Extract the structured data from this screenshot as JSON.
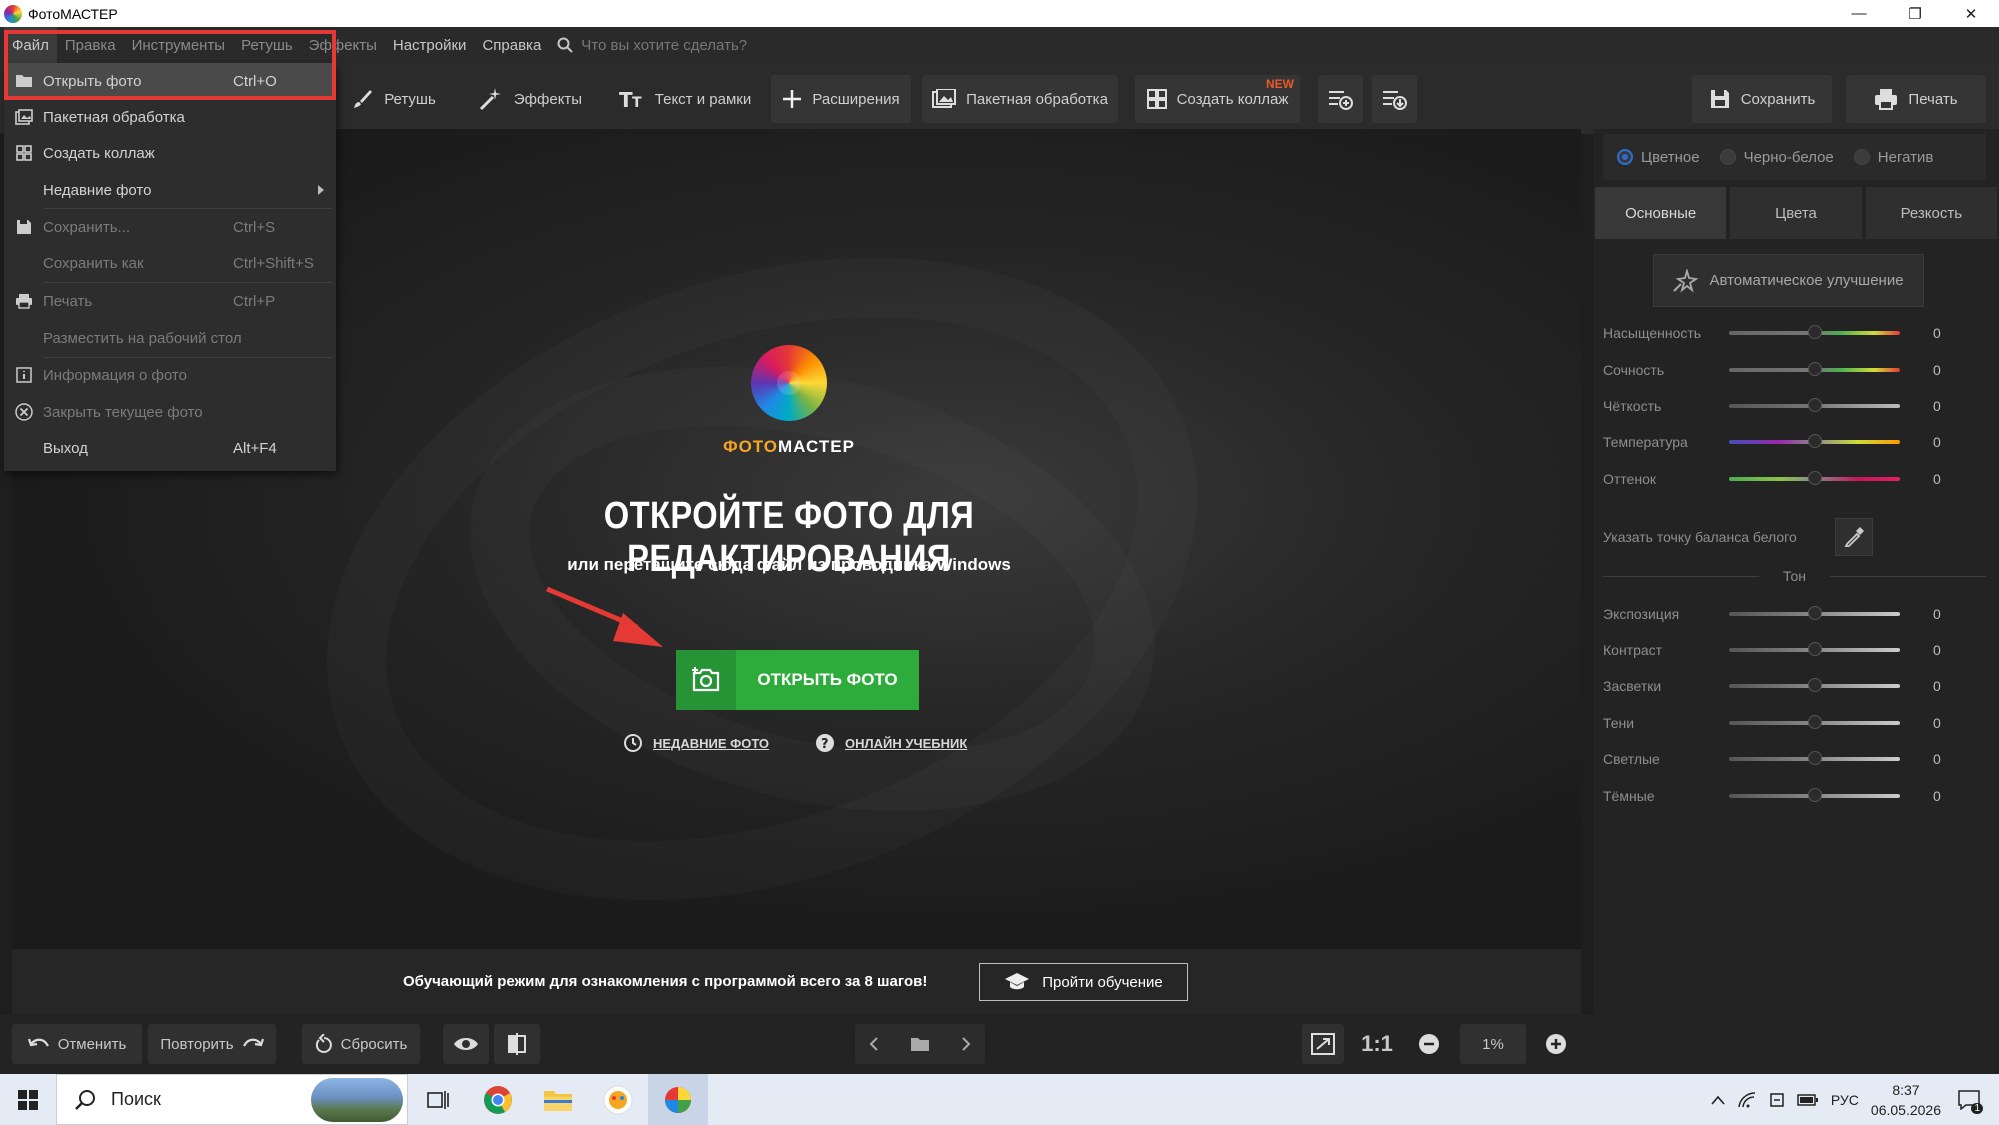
{
  "window": {
    "title": "ФотоМАСТЕР",
    "min": "—",
    "restore": "❐",
    "close": "✕"
  },
  "menubar": {
    "items": [
      "Файл",
      "Правка",
      "Инструменты",
      "Ретушь",
      "Эффекты",
      "Настройки",
      "Справка"
    ],
    "search_placeholder": "Что вы хотите сделать?"
  },
  "toolbar": {
    "retouch": "Ретушь",
    "effects": "Эффекты",
    "text_frames": "Текст и рамки",
    "extensions": "Расширения",
    "batch": "Пакетная обработка",
    "collage": "Создать коллаж",
    "collage_badge": "NEW",
    "save": "Сохранить",
    "print": "Печать"
  },
  "file_menu": {
    "items": [
      {
        "label": "Открыть фото",
        "shortcut": "Ctrl+O",
        "icon": "folder-icon",
        "enabled": true,
        "highlighted": true
      },
      {
        "label": "Пакетная обработка",
        "shortcut": "",
        "icon": "images-icon",
        "enabled": true
      },
      {
        "label": "Создать коллаж",
        "shortcut": "",
        "icon": "collage-icon",
        "enabled": true
      },
      {
        "label": "Недавние фото",
        "shortcut": "",
        "icon": "",
        "enabled": true,
        "submenu": true
      },
      {
        "label": "Сохранить...",
        "shortcut": "Ctrl+S",
        "icon": "save-icon",
        "enabled": false
      },
      {
        "label": "Сохранить как",
        "shortcut": "Ctrl+Shift+S",
        "icon": "",
        "enabled": false
      },
      {
        "label": "Печать",
        "shortcut": "Ctrl+P",
        "icon": "printer-icon",
        "enabled": false
      },
      {
        "label": "Разместить на рабочий стол",
        "shortcut": "",
        "icon": "",
        "enabled": false
      },
      {
        "label": "Информация о фото",
        "shortcut": "",
        "icon": "info-icon",
        "enabled": false
      },
      {
        "label": "Закрыть текущее фото",
        "shortcut": "",
        "icon": "close-circle-icon",
        "enabled": false
      },
      {
        "label": "Выход",
        "shortcut": "Alt+F4",
        "icon": "",
        "enabled": true
      }
    ]
  },
  "welcome": {
    "brand_part1": "ФОТО",
    "brand_part2": "МАСТЕР",
    "headline": "ОТКРОЙТЕ ФОТО ДЛЯ РЕДАКТИРОВАНИЯ",
    "subline": "или перетащите сюда файл из проводника Windows",
    "open_button": "ОТКРЫТЬ ФОТО",
    "recent_link": "НЕДАВНИЕ ФОТО",
    "tutorial_link": "ОНЛАЙН УЧЕБНИК"
  },
  "tutorial_bar": {
    "text": "Обучающий режим для ознакомления с программой всего за 8 шагов!",
    "button": "Пройти обучение"
  },
  "bottombar": {
    "undo": "Отменить",
    "redo": "Повторить",
    "reset": "Сбросить",
    "ratio": "1:1",
    "zoom": "1%"
  },
  "right_panel": {
    "color_modes": [
      "Цветное",
      "Черно-белое",
      "Негатив"
    ],
    "selected_mode": "Цветное",
    "tabs": [
      "Основные",
      "Цвета",
      "Резкость"
    ],
    "active_tab": "Основные",
    "auto_button": "Автоматическое улучшение",
    "sliders": [
      {
        "label": "Насыщенность",
        "value": "0"
      },
      {
        "label": "Сочность",
        "value": "0"
      },
      {
        "label": "Чёткость",
        "value": "0"
      },
      {
        "label": "Температура",
        "value": "0"
      },
      {
        "label": "Оттенок",
        "value": "0"
      }
    ],
    "white_balance": "Указать точку баланса белого",
    "tone_title": "Тон",
    "tone_sliders": [
      {
        "label": "Экспозиция",
        "value": "0"
      },
      {
        "label": "Контраст",
        "value": "0"
      },
      {
        "label": "Засветки",
        "value": "0"
      },
      {
        "label": "Тени",
        "value": "0"
      },
      {
        "label": "Светлые",
        "value": "0"
      },
      {
        "label": "Тёмные",
        "value": "0"
      }
    ]
  },
  "taskbar": {
    "search": "Поиск",
    "lang": "РУС",
    "time": "8:37",
    "date": "06.05.2026",
    "notifications": "1"
  },
  "colors": {
    "accent_green": "#2eac3b",
    "highlight_red": "#e53935",
    "new_badge": "#e85a2a",
    "radio_blue": "#2a6fd6"
  }
}
